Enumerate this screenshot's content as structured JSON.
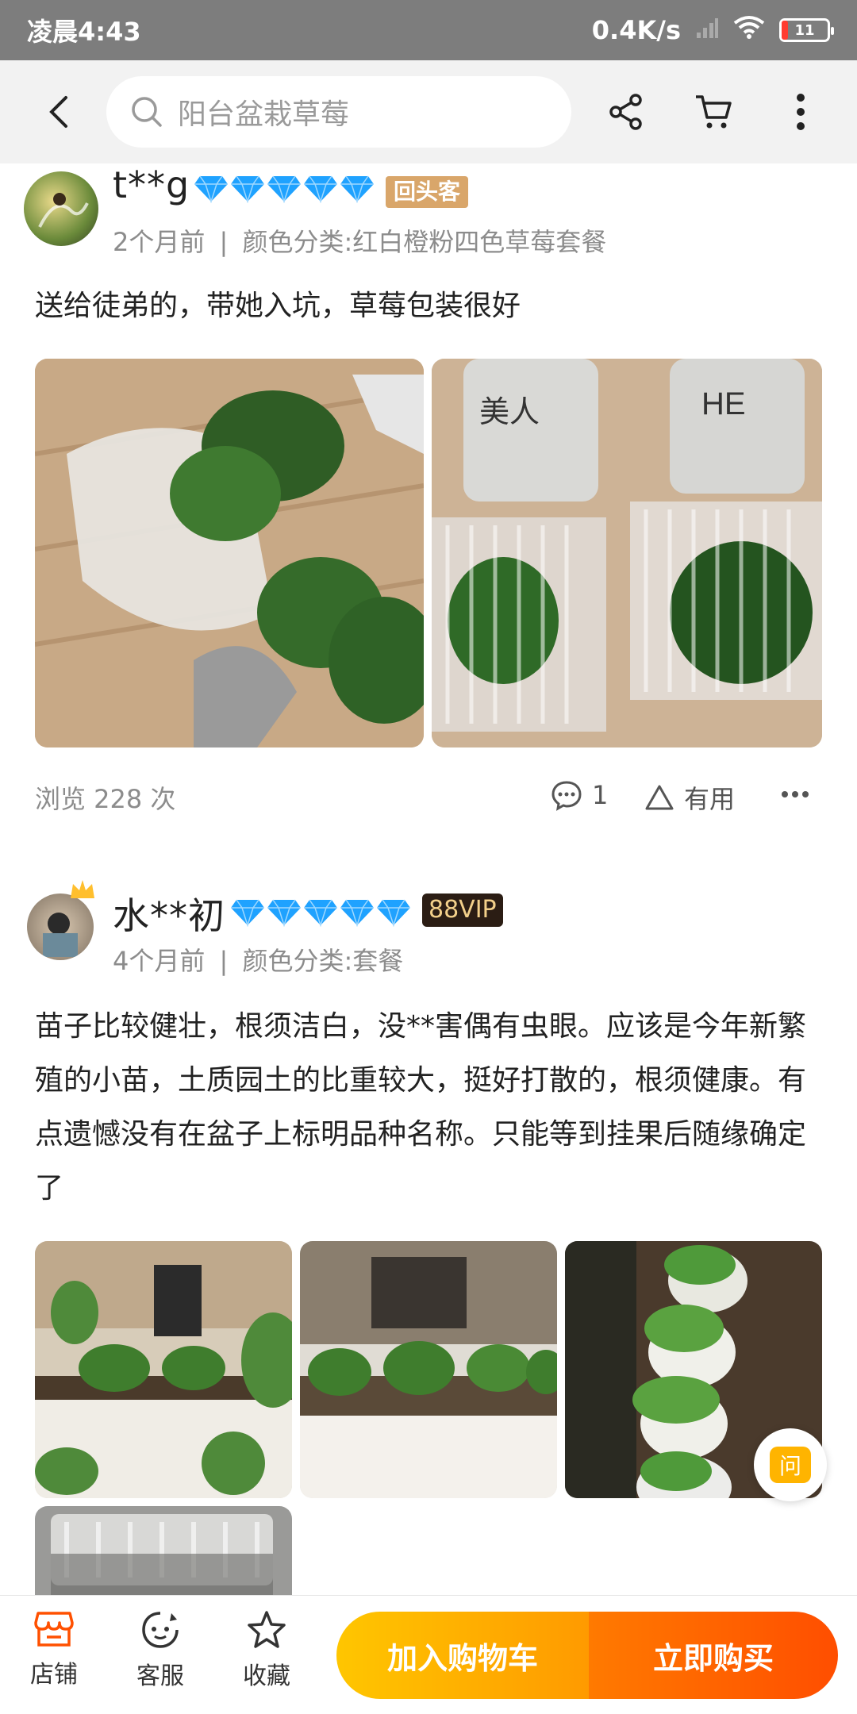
{
  "status_bar": {
    "time": "凌晨4:43",
    "speed": "0.4K/s",
    "battery": "11"
  },
  "search": {
    "placeholder": "阳台盆栽草莓"
  },
  "reviews": [
    {
      "username": "t**g",
      "badge": "回头客",
      "time": "2个月前",
      "variant": "颜色分类:红白橙粉四色草莓套餐",
      "text": "送给徒弟的，带她入坑，草莓包装很好",
      "views": "浏览 228 次",
      "comments": "1",
      "useful": "有用"
    },
    {
      "username": "水**初",
      "badge": "88VIP",
      "time": "4个月前",
      "variant": "颜色分类:套餐",
      "text": "苗子比较健壮，根须洁白，没**害偶有虫眼。应该是今年新繁殖的小苗，土质园土的比重较大，挺好打散的，根须健康。有点遗憾没有在盆子上标明品种名称。只能等到挂果后随缘确定了"
    }
  ],
  "float_button": {
    "label": "问"
  },
  "bottom_bar": {
    "tabs": [
      {
        "label": "店铺"
      },
      {
        "label": "客服"
      },
      {
        "label": "收藏"
      }
    ],
    "add_to_cart": "加入购物车",
    "buy_now": "立即购买"
  },
  "colors": {
    "accent_orange": "#ff5000",
    "accent_yellow": "#ffc600",
    "status_bar": "#7d7d7d",
    "diamond": "#1fa2ff"
  }
}
